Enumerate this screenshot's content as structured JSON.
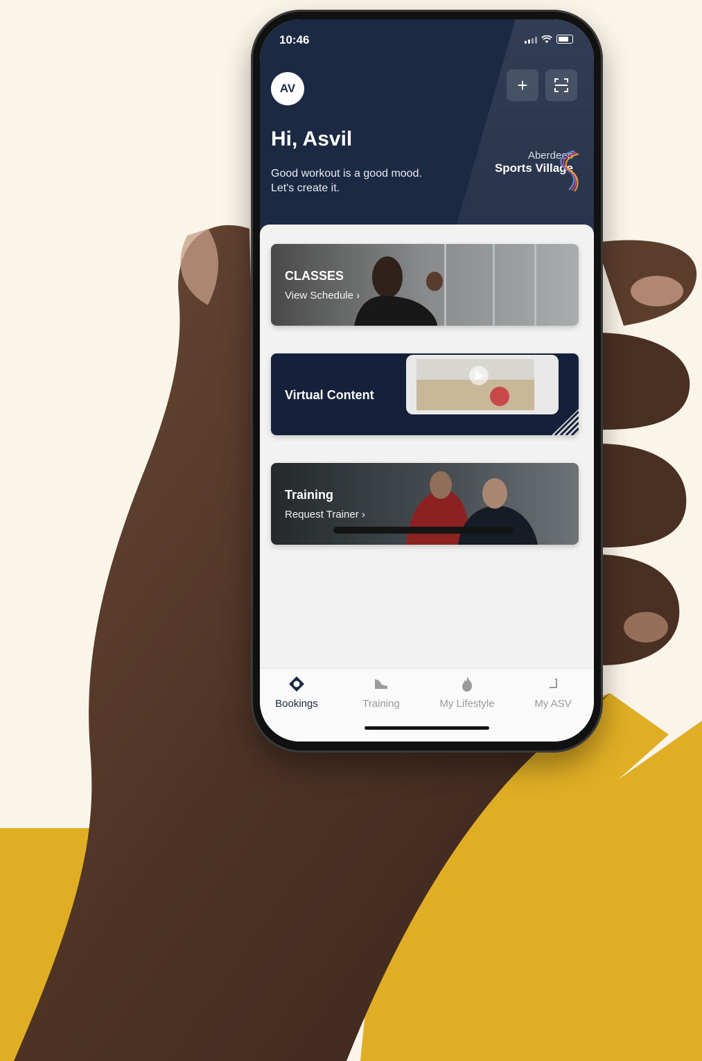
{
  "status": {
    "time": "10:46"
  },
  "header": {
    "avatar_initials": "AV",
    "greeting": "Hi, Asvil",
    "tagline_line1": "Good workout is a good mood.",
    "tagline_line2": "Let's create it.",
    "brand_line1": "Aberdeen",
    "brand_line2": "Sports Village",
    "add_icon": "plus-icon",
    "scan_icon": "scan-icon"
  },
  "cards": [
    {
      "title": "CLASSES",
      "subtitle": "View Schedule"
    },
    {
      "title": "Virtual Content"
    },
    {
      "title": "Training",
      "subtitle": "Request Trainer"
    }
  ],
  "tabs": [
    {
      "label": "Bookings",
      "icon": "bookings-icon",
      "active": true
    },
    {
      "label": "Training",
      "icon": "training-shoe-icon",
      "active": false
    },
    {
      "label": "My Lifestyle",
      "icon": "flame-icon",
      "active": false
    },
    {
      "label": "My ASV",
      "icon": "profile-icon",
      "active": false
    }
  ],
  "colors": {
    "navy": "#1c2942",
    "mustard": "#dfae24",
    "cream": "#fbf4e8"
  }
}
